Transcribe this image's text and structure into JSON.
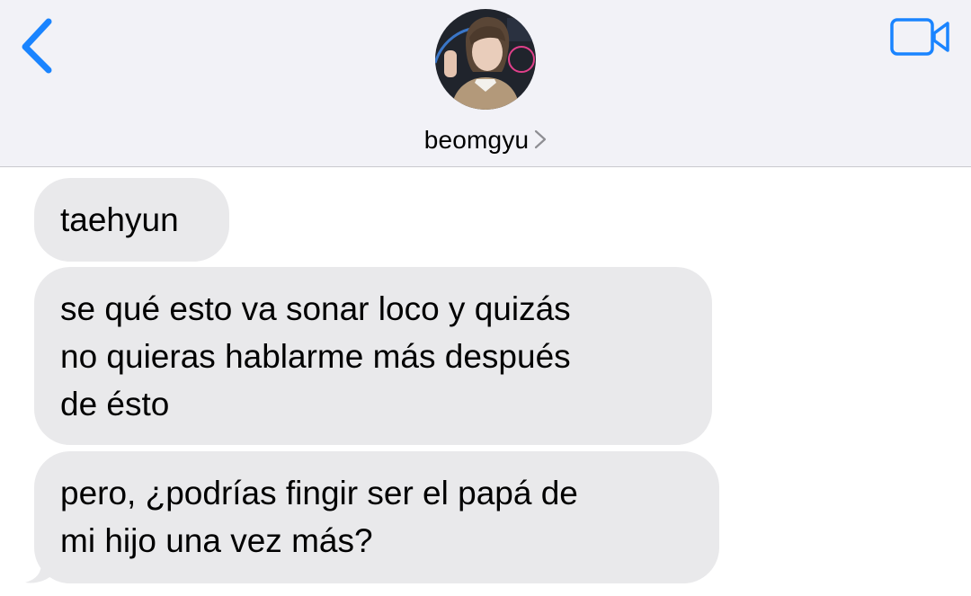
{
  "header": {
    "contact_name": "beomgyu",
    "back_icon": "chevron-left-icon",
    "video_icon": "video-camera-icon",
    "accent_color": "#1a84ff"
  },
  "messages": [
    {
      "direction": "incoming",
      "text": "taehyun"
    },
    {
      "direction": "incoming",
      "text": "se qué esto va sonar loco y quizás\nno quieras hablarme más después\nde ésto"
    },
    {
      "direction": "incoming",
      "text": "pero, ¿podrías fingir ser el papá de\nmi hijo una vez más?"
    }
  ]
}
